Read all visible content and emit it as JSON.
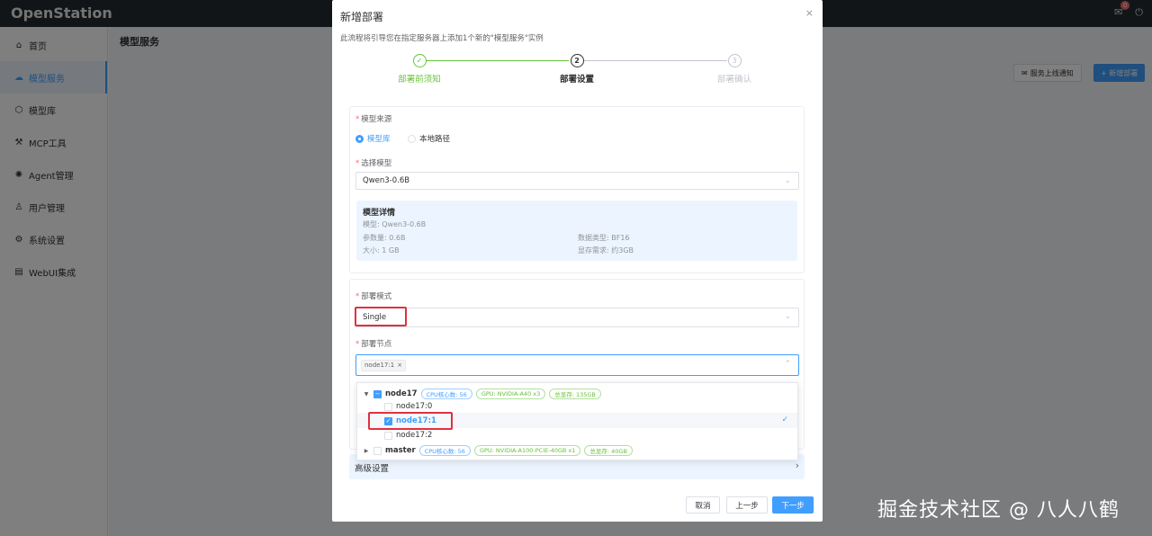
{
  "app": {
    "brand": "OpenStation",
    "badge_count": "0"
  },
  "sidebar": {
    "items": [
      {
        "label": "首页",
        "icon": "home-icon"
      },
      {
        "label": "模型服务",
        "icon": "service-icon"
      },
      {
        "label": "模型库",
        "icon": "model-library-icon"
      },
      {
        "label": "MCP工具",
        "icon": "tool-icon"
      },
      {
        "label": "Agent管理",
        "icon": "agent-icon"
      },
      {
        "label": "用户管理",
        "icon": "user-icon"
      },
      {
        "label": "系统设置",
        "icon": "gear-icon"
      },
      {
        "label": "WebUI集成",
        "icon": "webui-icon"
      }
    ]
  },
  "main": {
    "title": "模型服务",
    "notify_button": "服务上线通知",
    "new_button": "+ 新增部署"
  },
  "dialog": {
    "title": "新增部署",
    "close": "×",
    "description": "此流程将引导您在指定服务器上添加1个新的\"模型服务\"实例",
    "steps": [
      {
        "label": "部署前须知",
        "icon": "✓",
        "status": "done"
      },
      {
        "label": "部署设置",
        "icon": "2",
        "status": "active"
      },
      {
        "label": "部署确认",
        "icon": "3",
        "status": "pending"
      }
    ],
    "model_source": {
      "label": "模型来源",
      "options": [
        "模型库",
        "本地路径"
      ],
      "selected": "模型库"
    },
    "select_model": {
      "label": "选择模型",
      "value": "Qwen3-0.6B"
    },
    "model_detail": {
      "title": "模型详情",
      "model": "模型:  Qwen3-0.6B",
      "params": "参数量:  0.6B",
      "size": "大小:  1 GB",
      "dtype": "数据类型:  BF16",
      "memory": "显存需求:  约3GB"
    },
    "deploy_mode": {
      "label": "部署模式",
      "value": "Single"
    },
    "deploy_node": {
      "label": "部署节点",
      "tag": "node17:1",
      "tag_close": "×"
    },
    "tree": [
      {
        "name": "node17",
        "cpu": "CPU核心数: 56",
        "gpu": "GPU: NVIDIA-A40 x3",
        "mem": "总显存: 135GB",
        "children": [
          "node17:0",
          "node17:1",
          "node17:2"
        ]
      },
      {
        "name": "master",
        "cpu": "CPU核心数: 56",
        "gpu": "GPU: NVIDIA-A100-PCIE-40GB x1",
        "mem": "总显存: 40GB"
      }
    ],
    "selected_check": "✓",
    "advanced": "高级设置",
    "buttons": {
      "cancel": "取消",
      "prev": "上一步",
      "next": "下一步"
    }
  },
  "watermark": "掘金技术社区 @ 八人八鹤"
}
